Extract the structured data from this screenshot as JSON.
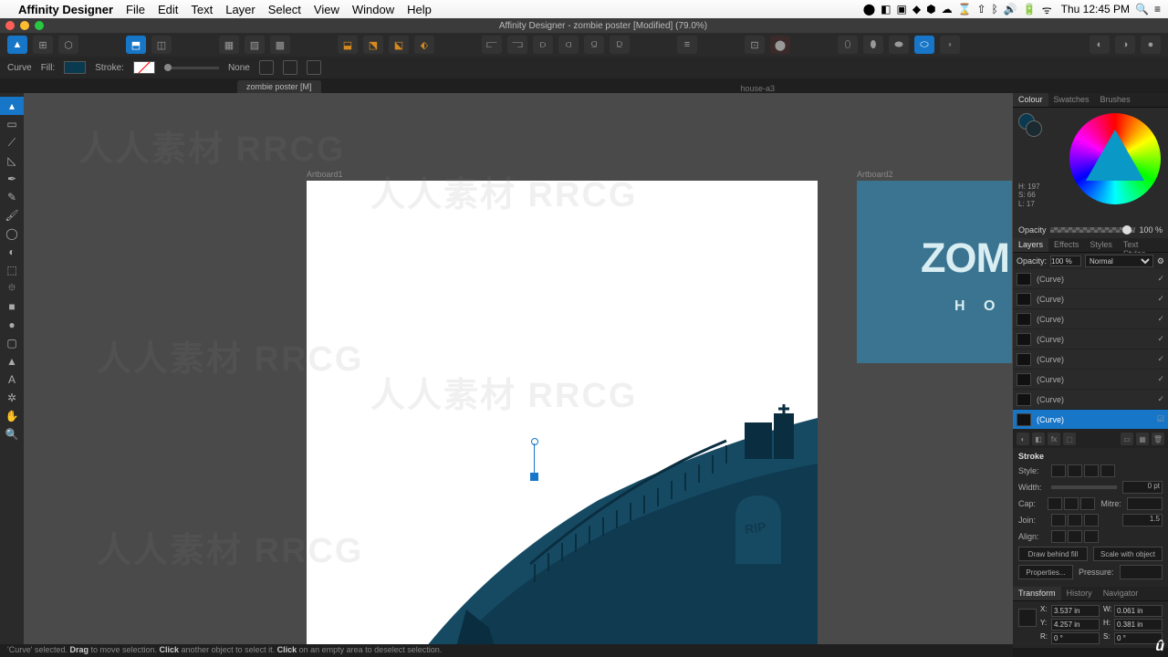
{
  "menubar": {
    "app": "Affinity Designer",
    "items": [
      "File",
      "Edit",
      "Text",
      "Layer",
      "Select",
      "View",
      "Window",
      "Help"
    ],
    "clock": "Thu 12:45 PM"
  },
  "title": "Affinity Designer - zombie poster [Modified] (79.0%)",
  "context": {
    "shape": "Curve",
    "fill": "Fill:",
    "stroke": "Stroke:",
    "strokeVal": "None"
  },
  "doc_tab": "zombie poster [M]",
  "constraint_tab": "house-a3",
  "artboard1": "Artboard1",
  "artboard2": "Artboard2",
  "ab2_text": "ZOM",
  "ab2_sub": "H O",
  "panels": {
    "colour_tabs": [
      "Colour",
      "Swatches",
      "Brushes"
    ],
    "hsl": {
      "h": "H: 197",
      "s": "S: 66",
      "l": "L: 17"
    },
    "opacity_label": "Opacity",
    "opacity_val": "100 %",
    "layer_tabs": [
      "Layers",
      "Effects",
      "Styles",
      "Text Styles"
    ],
    "layer_opacity_label": "Opacity:",
    "layer_opacity": "100 %",
    "blend": "Normal",
    "layers": [
      {
        "name": "(Curve)",
        "sel": false
      },
      {
        "name": "(Curve)",
        "sel": false
      },
      {
        "name": "(Curve)",
        "sel": false
      },
      {
        "name": "(Curve)",
        "sel": false
      },
      {
        "name": "(Curve)",
        "sel": false
      },
      {
        "name": "(Curve)",
        "sel": false
      },
      {
        "name": "(Curve)",
        "sel": false
      },
      {
        "name": "(Curve)",
        "sel": true
      }
    ],
    "stroke": {
      "title": "Stroke",
      "style": "Style:",
      "width": "Width:",
      "width_val": "0 pt",
      "cap": "Cap:",
      "mitre": "Mitre:",
      "mitre_val": "",
      "join": "Join:",
      "join_val": "1.5",
      "align": "Align:",
      "behind": "Draw behind fill",
      "scale": "Scale with object",
      "properties": "Properties...",
      "pressure": "Pressure:"
    },
    "transform": {
      "tabs": [
        "Transform",
        "History",
        "Navigator"
      ],
      "x": "3.537 in",
      "y": "4.257 in",
      "w": "0.061 in",
      "h": "0.381 in",
      "r": "0 °",
      "s": "0 °"
    }
  },
  "status": "'Curve' selected. Drag to move selection. Click another object to select it. Click on an empty area to deselect selection.",
  "status_parts": {
    "a": "'Curve' selected. ",
    "b": "Drag",
    "c": " to move selection. ",
    "d": "Click",
    "e": " another object to select it. ",
    "f": "Click",
    "g": " on an empty area to deselect selection."
  },
  "watermark": "人人素材 RRCG"
}
